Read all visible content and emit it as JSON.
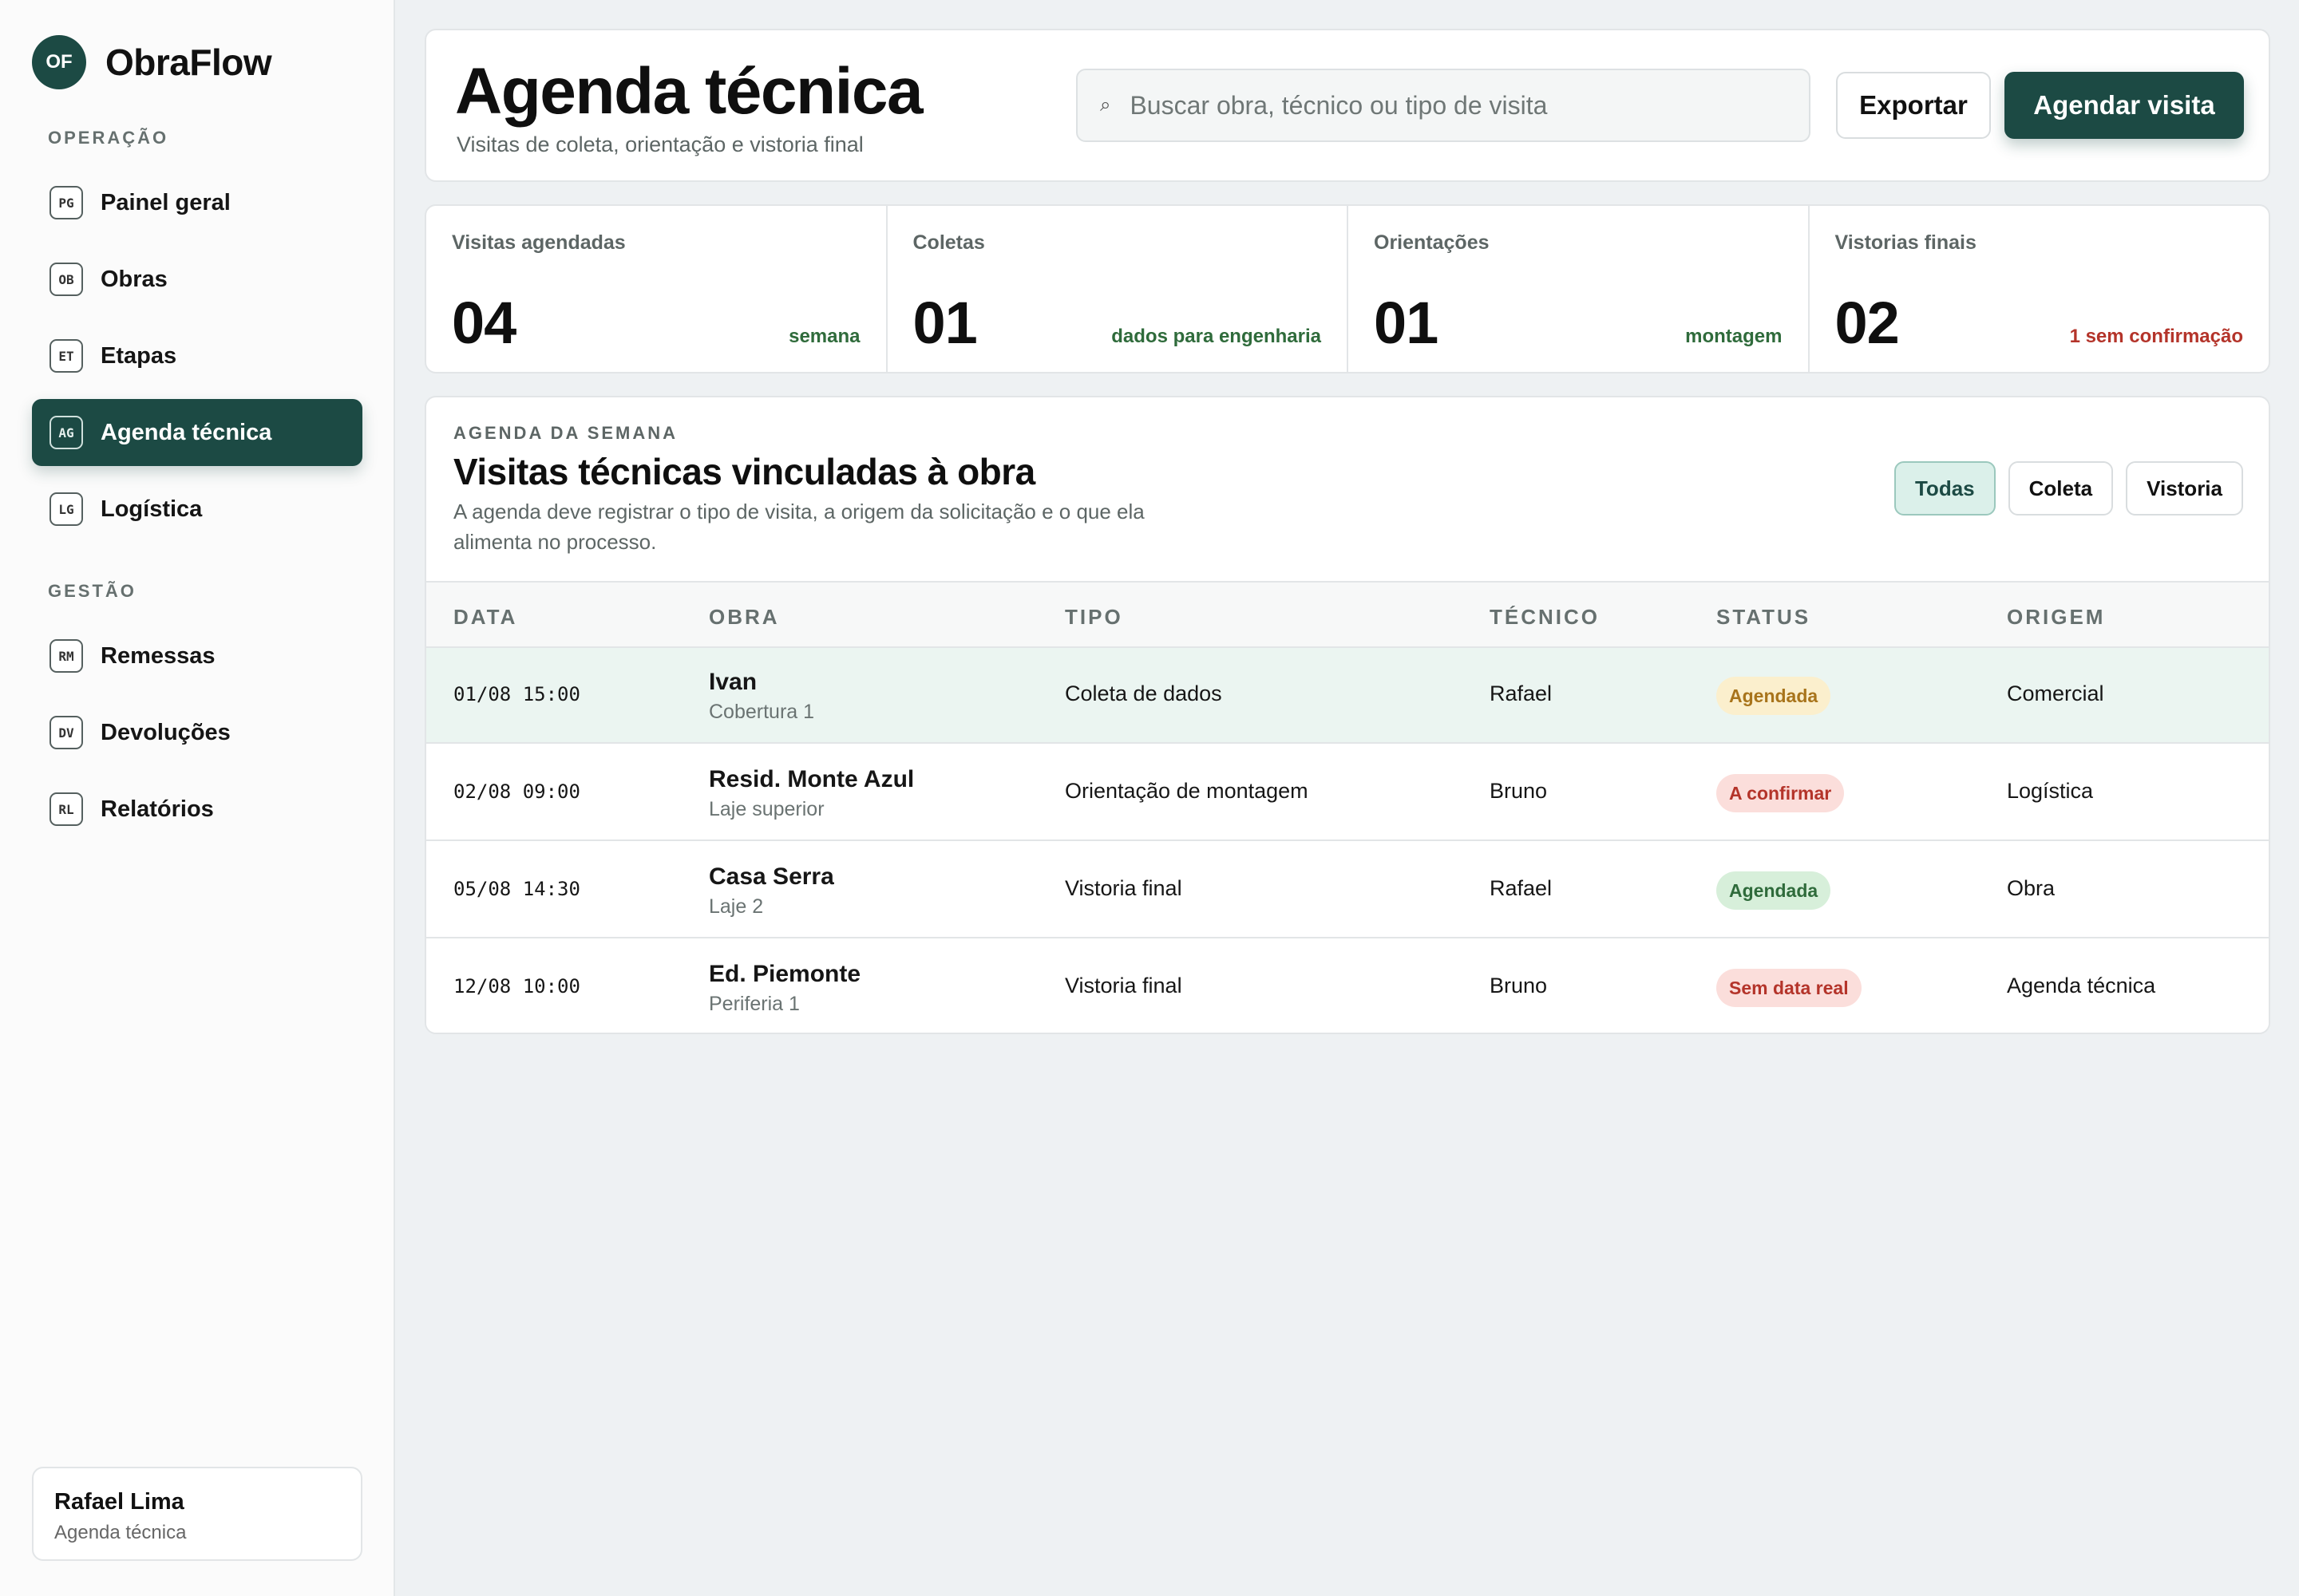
{
  "brand": {
    "logo": "OF",
    "name": "ObraFlow"
  },
  "sidebar": {
    "section_operacao": "OPERAÇÃO",
    "section_gestao": "GESTÃO",
    "items": [
      {
        "badge": "PG",
        "label": "Painel geral"
      },
      {
        "badge": "OB",
        "label": "Obras"
      },
      {
        "badge": "ET",
        "label": "Etapas"
      },
      {
        "badge": "AG",
        "label": "Agenda técnica"
      },
      {
        "badge": "LG",
        "label": "Logística"
      },
      {
        "badge": "RM",
        "label": "Remessas"
      },
      {
        "badge": "DV",
        "label": "Devoluções"
      },
      {
        "badge": "RL",
        "label": "Relatórios"
      }
    ],
    "user": {
      "name": "Rafael Lima",
      "role": "Agenda técnica"
    }
  },
  "header": {
    "title": "Agenda técnica",
    "subtitle": "Visitas de coleta, orientação e vistoria final",
    "search_placeholder": "Buscar obra, técnico ou tipo de visita",
    "search_icon": "⌕",
    "export_label": "Exportar",
    "primary_label": "Agendar visita"
  },
  "stats": [
    {
      "label": "Visitas agendadas",
      "value": "04",
      "note": "semana"
    },
    {
      "label": "Coletas",
      "value": "01",
      "note": "dados para engenharia"
    },
    {
      "label": "Orientações",
      "value": "01",
      "note": "montagem"
    },
    {
      "label": "Vistorias finais",
      "value": "02",
      "note": "1 sem confirmação"
    }
  ],
  "agenda": {
    "eyebrow": "AGENDA DA SEMANA",
    "title": "Visitas técnicas vinculadas à obra",
    "description": "A agenda deve registrar o tipo de visita, a origem da solicitação e o que ela alimenta no processo.",
    "filters": [
      "Todas",
      "Coleta",
      "Vistoria"
    ],
    "columns": [
      "DATA",
      "OBRA",
      "TIPO",
      "TÉCNICO",
      "STATUS",
      "ORIGEM"
    ],
    "rows": [
      {
        "date": "01/08 15:00",
        "obra": "Ivan",
        "obra_sub": "Cobertura 1",
        "tipo": "Coleta de dados",
        "tecnico": "Rafael",
        "status": "Agendada",
        "origem": "Comercial"
      },
      {
        "date": "02/08 09:00",
        "obra": "Resid. Monte Azul",
        "obra_sub": "Laje superior",
        "tipo": "Orientação de montagem",
        "tecnico": "Bruno",
        "status": "A confirmar",
        "origem": "Logística"
      },
      {
        "date": "05/08 14:30",
        "obra": "Casa Serra",
        "obra_sub": "Laje 2",
        "tipo": "Vistoria final",
        "tecnico": "Rafael",
        "status": "Agendada",
        "origem": "Obra"
      },
      {
        "date": "12/08 10:00",
        "obra": "Ed. Piemonte",
        "obra_sub": "Periferia 1",
        "tipo": "Vistoria final",
        "tecnico": "Bruno",
        "status": "Sem data real",
        "origem": "Agenda técnica"
      }
    ]
  },
  "colors": {
    "primary": "#1c4a44",
    "status_yellow": "#a8741b",
    "status_red": "#b4342a",
    "status_green": "#2f6b3b"
  }
}
